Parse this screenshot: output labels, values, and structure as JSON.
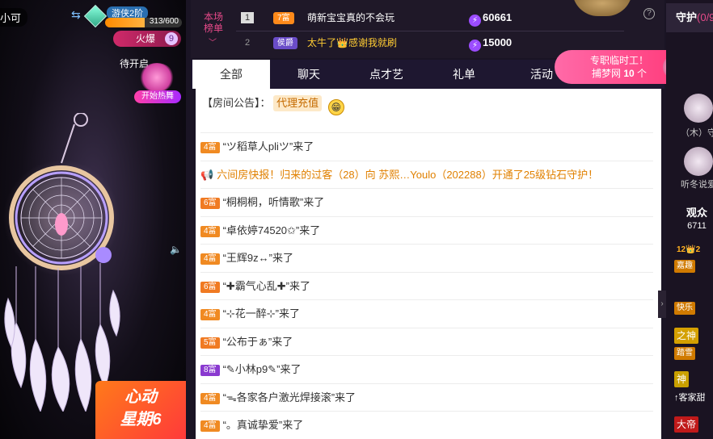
{
  "stage": {
    "anchor_name": "小可",
    "level_label": "游侠2阶",
    "exp_text": "313/600",
    "exp_fraction": 0.52,
    "heat_label": "火爆",
    "heat_count": "9",
    "pending_label": "待开启",
    "start_heat_label": "开始热舞",
    "promo_line1": "心动",
    "promo_line2": "星期6"
  },
  "rank": {
    "title": "本场榜单",
    "rows": [
      {
        "num": "1",
        "tag": "7富",
        "tag_color": "#ff8a1a",
        "nick": "萌新宝宝真的不会玩",
        "points": "60661"
      },
      {
        "num": "2",
        "tag": "侯爵",
        "tag_color": "#6a4cc8",
        "nick": "太牛了👑感谢我就刷",
        "points": "15000"
      }
    ]
  },
  "tabs": [
    "全部",
    "聊天",
    "点才艺",
    "礼单",
    "活动"
  ],
  "notice": {
    "label": "【房间公告】：",
    "chip": "代理充值"
  },
  "messages": [
    {
      "rank": "4富",
      "color": "#f08a22",
      "text": "“ツ稻草人pliツ”来了"
    },
    {
      "system": true,
      "text": "六间房快报！归来的过客（28）向 苏熙…Youlo（202288）开通了25级钻石守护！"
    },
    {
      "rank": "6富",
      "color": "#f07a22",
      "text": "“桐桐桐，听情歌”来了"
    },
    {
      "rank": "4富",
      "color": "#f08a22",
      "text": "“卓依婷74520✩”来了"
    },
    {
      "rank": "4富",
      "color": "#f08a22",
      "text": "“王辉9z↔”来了"
    },
    {
      "rank": "6富",
      "color": "#f07a22",
      "text": "“✚霸气心乱✚”来了"
    },
    {
      "rank": "4富",
      "color": "#f08a22",
      "text": "“⊹花一醉⊹”来了"
    },
    {
      "rank": "5富",
      "color": "#f07a22",
      "text": "“公布于ぁ”来了"
    },
    {
      "rank": "8富",
      "color": "#8a3ad0",
      "text": "“✎小林p9✎”来了"
    },
    {
      "rank": "4富",
      "color": "#f08a22",
      "text": "“ᯓ各家各户激光焊接滚”来了"
    },
    {
      "rank": "4富",
      "color": "#f08a22",
      "text": "“。真诚挚爱”来了"
    }
  ],
  "promo_tag": {
    "line1": "专职临时工！",
    "line2_prefix": "捕梦网",
    "line2_count": "10",
    "line2_suffix": "个"
  },
  "side": {
    "guard_label": "守护",
    "guard_count": "(0/9",
    "member1_name": "（木）守",
    "member2_name": "听冬说爱",
    "audience_label": "观众",
    "audience_count": "6711",
    "badges": [
      {
        "text": "12👑2",
        "color": "#d07a00"
      },
      {
        "text": "嘉趣",
        "color": "#d07a00"
      },
      {
        "text": "快乐",
        "color": "#d07a00"
      },
      {
        "text": "之神",
        "color": "#d4a000"
      },
      {
        "text": "踏雪",
        "color": "#d07a00"
      },
      {
        "text": "神",
        "color": "#c9a000"
      },
      {
        "text": "↑客家甜",
        "color": "transparent"
      },
      {
        "text": "大帝",
        "color": "#c01a1a"
      }
    ]
  }
}
